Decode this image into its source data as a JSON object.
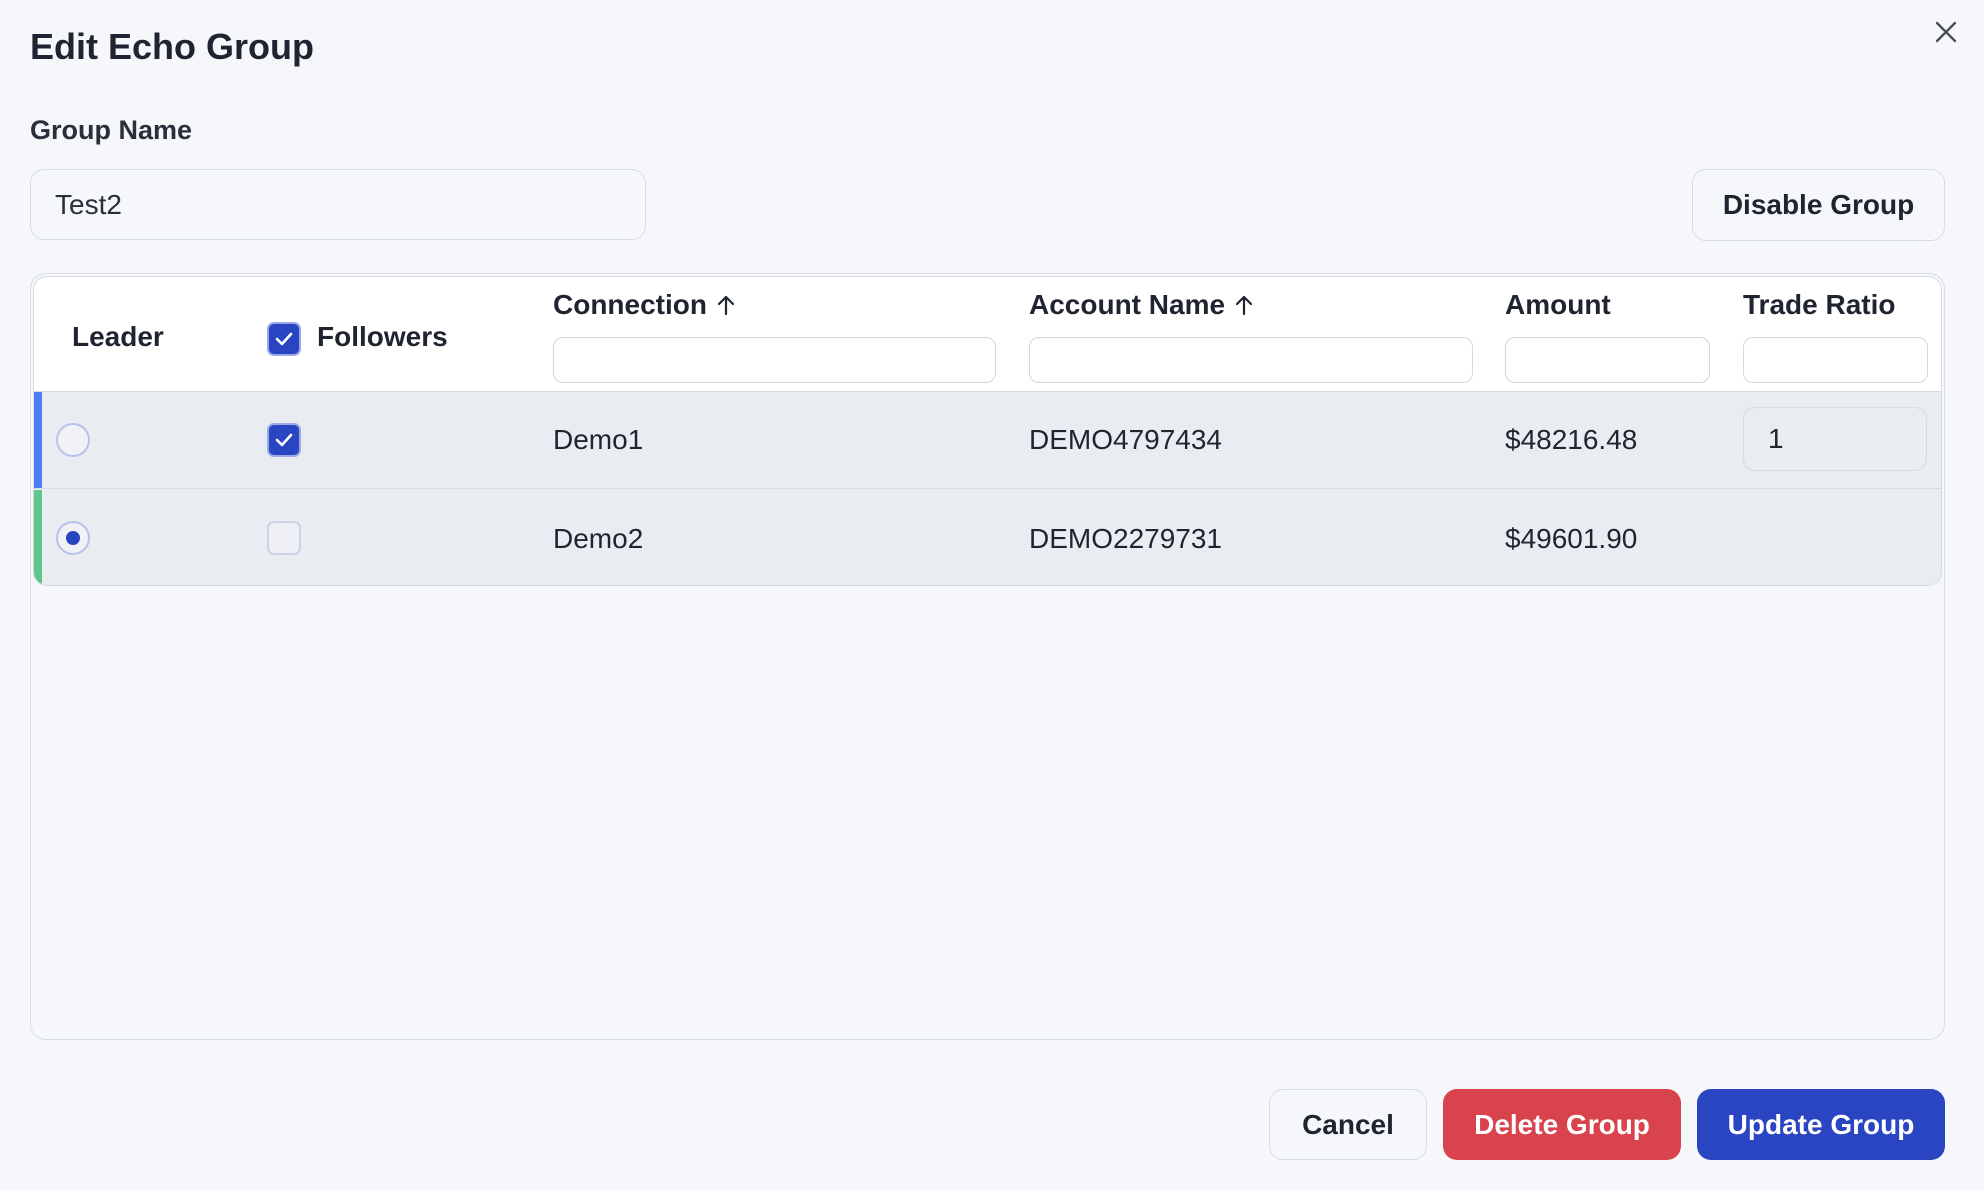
{
  "dialog": {
    "title": "Edit Echo Group",
    "close_icon": "close-icon"
  },
  "form": {
    "group_name_label": "Group Name",
    "group_name_value": "Test2",
    "disable_button": "Disable Group"
  },
  "table": {
    "columns": {
      "leader": "Leader",
      "followers": "Followers",
      "connection": "Connection",
      "account_name": "Account Name",
      "amount": "Amount",
      "trade_ratio": "Trade Ratio"
    },
    "sort_icons": {
      "connection": "arrow-up-icon",
      "account_name": "arrow-up-icon"
    },
    "followers_header_checked": true,
    "rows": [
      {
        "leader_selected": false,
        "follower_checked": true,
        "connection": "Demo1",
        "account_name": "DEMO4797434",
        "amount": "$48216.48",
        "trade_ratio": "1",
        "accent_color": "#4f7cf0"
      },
      {
        "leader_selected": true,
        "follower_checked": false,
        "connection": "Demo2",
        "account_name": "DEMO2279731",
        "amount": "$49601.90",
        "trade_ratio": "",
        "accent_color": "#5cc98b"
      }
    ]
  },
  "footer": {
    "cancel": "Cancel",
    "delete": "Delete Group",
    "update": "Update Group"
  },
  "colors": {
    "primary": "#2a45c2",
    "danger": "#d9434d",
    "background": "#f5f7fb"
  }
}
